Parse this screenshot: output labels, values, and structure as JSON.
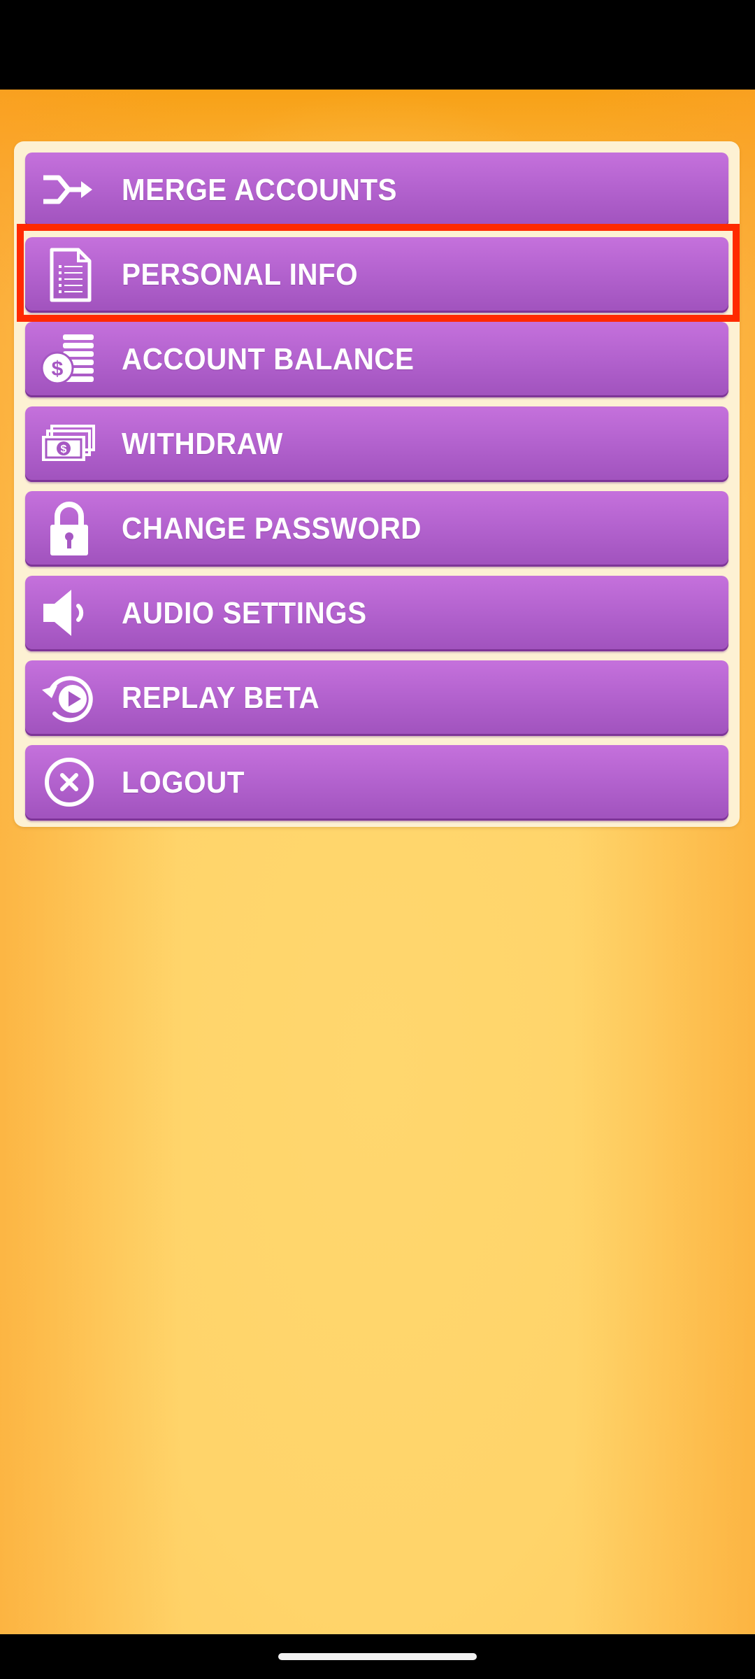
{
  "menu": {
    "items": [
      {
        "label": "MERGE ACCOUNTS",
        "icon": "merge-icon"
      },
      {
        "label": "PERSONAL INFO",
        "icon": "document-icon"
      },
      {
        "label": "ACCOUNT BALANCE",
        "icon": "coins-icon"
      },
      {
        "label": "WITHDRAW",
        "icon": "banknotes-icon"
      },
      {
        "label": "CHANGE PASSWORD",
        "icon": "lock-icon"
      },
      {
        "label": "AUDIO SETTINGS",
        "icon": "speaker-icon"
      },
      {
        "label": "REPLAY BETA",
        "icon": "replay-icon"
      },
      {
        "label": "LOGOUT",
        "icon": "close-circle-icon"
      }
    ]
  },
  "colors": {
    "button": "#b463cf",
    "panel": "#fdf1d3",
    "background": "#ffcc60",
    "highlight": "#ff2a00",
    "text": "#ffffff"
  }
}
